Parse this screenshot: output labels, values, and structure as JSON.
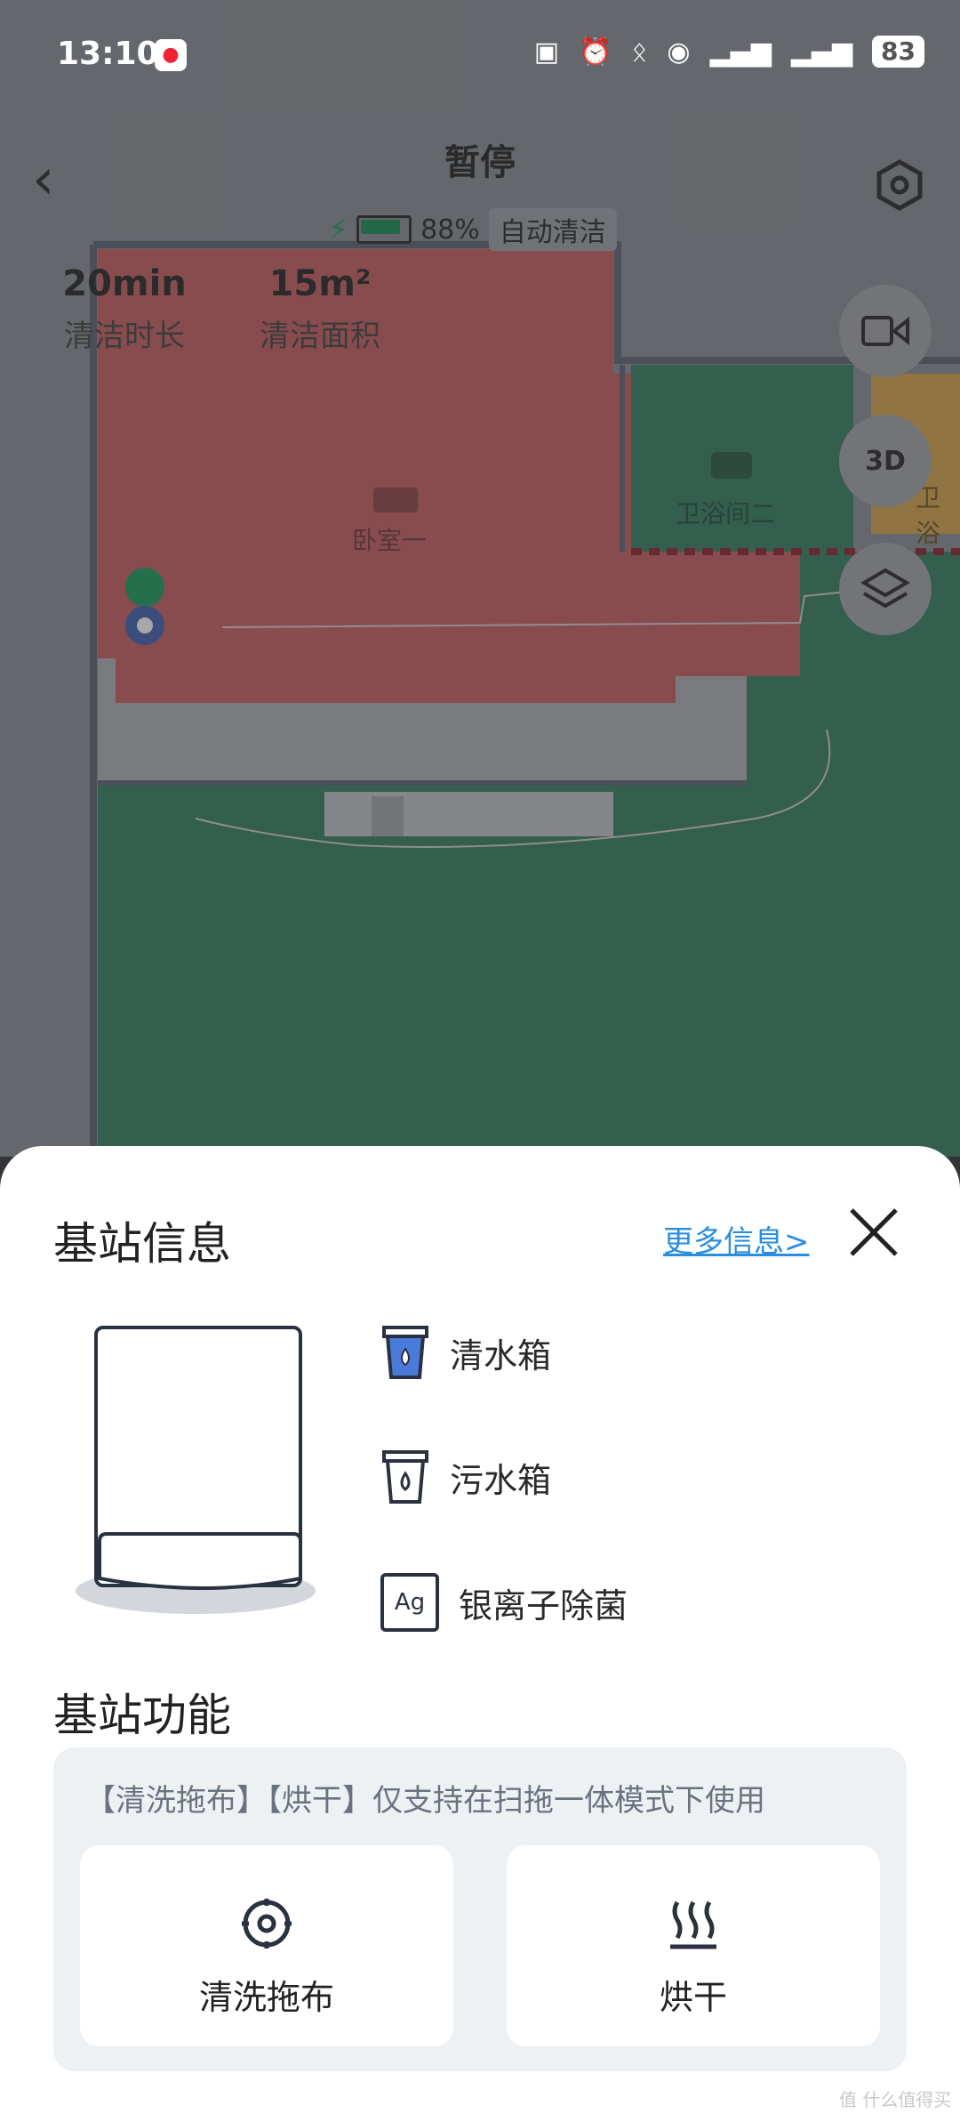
{
  "status_bar": {
    "time": "13:10",
    "app_icon": "map-pin-app-icon",
    "battery": "83"
  },
  "header": {
    "title": "暂停"
  },
  "robot_status": {
    "battery_pct": "88%",
    "mode": "自动清洁"
  },
  "stats": [
    {
      "value": "20min",
      "label": "清洁时长"
    },
    {
      "value": "15m²",
      "label": "清洁面积"
    }
  ],
  "map": {
    "rooms": [
      {
        "label": "卧室一"
      },
      {
        "label": "卫浴间二"
      },
      {
        "label": "卫浴"
      }
    ]
  },
  "side_buttons": {
    "three_d_label": "3D"
  },
  "sheet": {
    "title": "基站信息",
    "more_link": "更多信息>",
    "items": [
      {
        "label": "清水箱",
        "icon": "clean-water-tank-icon"
      },
      {
        "label": "污水箱",
        "icon": "dirty-water-tank-icon"
      },
      {
        "label": "银离子除菌",
        "icon": "silver-ion-icon"
      }
    ],
    "silver_icon_text": "Ag",
    "functions_title": "基站功能",
    "functions_note": "【清洗拖布】【烘干】仅支持在扫拖一体模式下使用",
    "functions": [
      {
        "label": "清洗拖布",
        "icon": "mop-wash-icon"
      },
      {
        "label": "烘干",
        "icon": "drying-icon"
      }
    ]
  },
  "watermark": "值 什么值得买",
  "colors": {
    "bedroom": "#c65a5e",
    "bathroom": "#2f7a5e",
    "accent_link": "#2a8ee0",
    "clean_water": "#4a7bd8"
  }
}
